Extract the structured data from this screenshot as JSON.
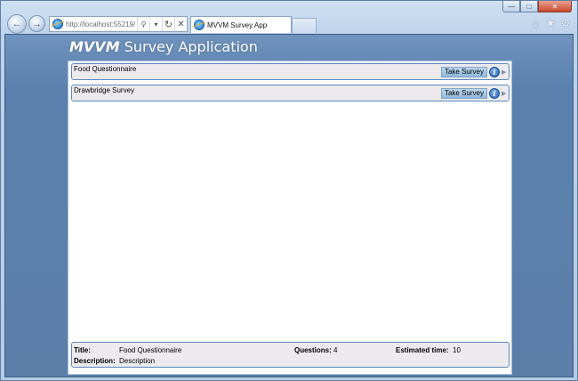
{
  "browser": {
    "url": "http://localhost:55219/",
    "tab_title": "MVVM Survey App"
  },
  "app": {
    "title_strong": "MVVM",
    "title_rest": "Survey Application"
  },
  "surveys": [
    {
      "name": "Food Questionnaire",
      "button_label": "Take Survey"
    },
    {
      "name": "Drawbridge Survey",
      "button_label": "Take Survey"
    }
  ],
  "details": {
    "title_label": "Title:",
    "title_value": "Food Questionnaire",
    "questions_label": "Questions:",
    "questions_value": "4",
    "time_label": "Estimated time:",
    "time_value": "10",
    "description_label": "Description:",
    "description_value": "Description"
  },
  "icons": {
    "info": "i",
    "info_color": "#245fb2",
    "accent": "#5a88c0"
  }
}
